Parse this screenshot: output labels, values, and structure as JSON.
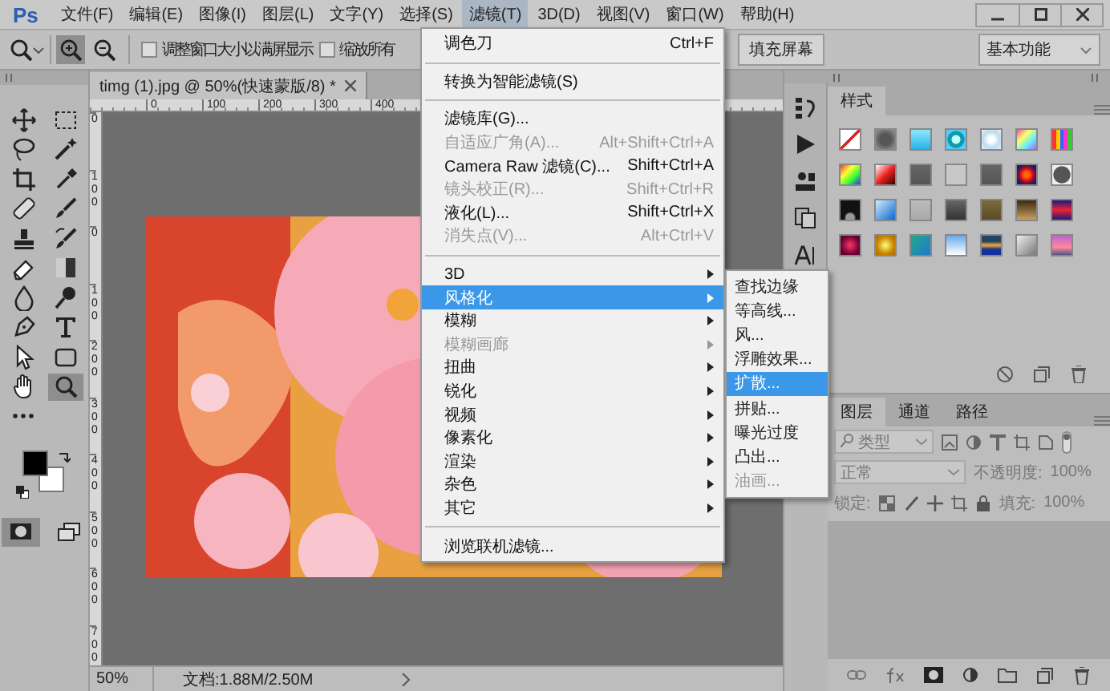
{
  "menubar": {
    "logo": "Ps",
    "menus": [
      {
        "label": "文件(F)",
        "selected": false
      },
      {
        "label": "编辑(E)",
        "selected": false
      },
      {
        "label": "图像(I)",
        "selected": false
      },
      {
        "label": "图层(L)",
        "selected": false
      },
      {
        "label": "文字(Y)",
        "selected": false
      },
      {
        "label": "选择(S)",
        "selected": false
      },
      {
        "label": "滤镜(T)",
        "selected": true
      },
      {
        "label": "3D(D)",
        "selected": false
      },
      {
        "label": "视图(V)",
        "selected": false
      },
      {
        "label": "窗口(W)",
        "selected": false
      },
      {
        "label": "帮助(H)",
        "selected": false
      }
    ]
  },
  "options_bar": {
    "zoom_buttons": [
      {
        "kind": "zoom-in",
        "selected": true
      },
      {
        "kind": "zoom-out",
        "selected": false
      }
    ],
    "checkboxes": [
      {
        "label": "调整窗口大小以满屏显示",
        "checked": false
      },
      {
        "label": "缩放所有",
        "checked": false
      }
    ],
    "fill_screen_button": "填充屏幕",
    "workspace": "基本功能"
  },
  "tools": [
    {
      "kind": "move",
      "selected": false
    },
    {
      "kind": "marquee",
      "selected": false
    },
    {
      "kind": "lasso",
      "selected": false
    },
    {
      "kind": "wand",
      "selected": false
    },
    {
      "kind": "crop",
      "selected": false
    },
    {
      "kind": "eyedropper",
      "selected": false
    },
    {
      "kind": "healing",
      "selected": false
    },
    {
      "kind": "brush",
      "selected": false
    },
    {
      "kind": "stamp",
      "selected": false
    },
    {
      "kind": "history-brush",
      "selected": false
    },
    {
      "kind": "eraser",
      "selected": false
    },
    {
      "kind": "gradient",
      "selected": false
    },
    {
      "kind": "blur",
      "selected": false
    },
    {
      "kind": "dodge",
      "selected": false
    },
    {
      "kind": "pen",
      "selected": false
    },
    {
      "kind": "type",
      "selected": false
    },
    {
      "kind": "path-select",
      "selected": false
    },
    {
      "kind": "rectangle",
      "selected": false
    },
    {
      "kind": "hand",
      "selected": false
    },
    {
      "kind": "zoom",
      "selected": true
    },
    {
      "kind": "more",
      "selected": false
    }
  ],
  "quick_mask": {
    "selected": true
  },
  "document": {
    "tab": "timg (1).jpg @ 50%(快速蒙版/8) *",
    "ruler_h": [
      "0",
      "100",
      "200",
      "300",
      "400"
    ],
    "ruler_v": [
      "0",
      "100",
      "0",
      "100",
      "200",
      "300",
      "400",
      "500",
      "600",
      "700"
    ],
    "image": {
      "kind": "picture"
    },
    "status": {
      "zoom": "50%",
      "doc_info": "文档:1.88M/2.50M"
    }
  },
  "filter_menu": {
    "items": [
      {
        "kind": "item",
        "label": "调色刀",
        "shortcut": "Ctrl+F",
        "disabled": false,
        "submenu": false,
        "selected": false
      },
      {
        "kind": "separator"
      },
      {
        "kind": "item",
        "label": "转换为智能滤镜(S)",
        "disabled": false,
        "submenu": false,
        "selected": false
      },
      {
        "kind": "separator"
      },
      {
        "kind": "item",
        "label": "滤镜库(G)...",
        "disabled": false,
        "submenu": false,
        "selected": false
      },
      {
        "kind": "item",
        "label": "自适应广角(A)...",
        "shortcut": "Alt+Shift+Ctrl+A",
        "disabled": true,
        "submenu": false,
        "selected": false
      },
      {
        "kind": "item",
        "label": "Camera Raw 滤镜(C)...",
        "shortcut": "Shift+Ctrl+A",
        "disabled": false,
        "submenu": false,
        "selected": false
      },
      {
        "kind": "item",
        "label": "镜头校正(R)...",
        "shortcut": "Shift+Ctrl+R",
        "disabled": true,
        "submenu": false,
        "selected": false
      },
      {
        "kind": "item",
        "label": "液化(L)...",
        "shortcut": "Shift+Ctrl+X",
        "disabled": false,
        "submenu": false,
        "selected": false
      },
      {
        "kind": "item",
        "label": "消失点(V)...",
        "shortcut": "Alt+Ctrl+V",
        "disabled": true,
        "submenu": false,
        "selected": false
      },
      {
        "kind": "separator"
      },
      {
        "kind": "item",
        "label": "3D",
        "disabled": false,
        "submenu": true,
        "selected": false
      },
      {
        "kind": "item",
        "label": "风格化",
        "disabled": false,
        "submenu": true,
        "selected": true
      },
      {
        "kind": "item",
        "label": "模糊",
        "disabled": false,
        "submenu": true,
        "selected": false
      },
      {
        "kind": "item",
        "label": "模糊画廊",
        "disabled": true,
        "submenu": true,
        "selected": false
      },
      {
        "kind": "item",
        "label": "扭曲",
        "disabled": false,
        "submenu": true,
        "selected": false
      },
      {
        "kind": "item",
        "label": "锐化",
        "disabled": false,
        "submenu": true,
        "selected": false
      },
      {
        "kind": "item",
        "label": "视频",
        "disabled": false,
        "submenu": true,
        "selected": false
      },
      {
        "kind": "item",
        "label": "像素化",
        "disabled": false,
        "submenu": true,
        "selected": false
      },
      {
        "kind": "item",
        "label": "渲染",
        "disabled": false,
        "submenu": true,
        "selected": false
      },
      {
        "kind": "item",
        "label": "杂色",
        "disabled": false,
        "submenu": true,
        "selected": false
      },
      {
        "kind": "item",
        "label": "其它",
        "disabled": false,
        "submenu": true,
        "selected": false
      },
      {
        "kind": "separator"
      },
      {
        "kind": "item",
        "label": "浏览联机滤镜...",
        "disabled": false,
        "submenu": false,
        "selected": false
      }
    ]
  },
  "stylize_submenu": {
    "items": [
      {
        "label": "查找边缘",
        "disabled": false,
        "selected": false
      },
      {
        "label": "等高线...",
        "disabled": false,
        "selected": false
      },
      {
        "label": "风...",
        "disabled": false,
        "selected": false
      },
      {
        "label": "浮雕效果...",
        "disabled": false,
        "selected": false
      },
      {
        "label": "扩散...",
        "disabled": false,
        "selected": true
      },
      {
        "label": "拼贴...",
        "disabled": false,
        "selected": false
      },
      {
        "label": "曝光过度",
        "disabled": false,
        "selected": false
      },
      {
        "label": "凸出...",
        "disabled": false,
        "selected": false
      },
      {
        "label": "油画...",
        "disabled": true,
        "selected": false
      }
    ]
  },
  "styles_panel": {
    "tab": "样式"
  },
  "layers_panel": {
    "tabs": [
      {
        "label": "图层",
        "selected": true
      },
      {
        "label": "通道",
        "selected": false
      },
      {
        "label": "路径",
        "selected": false
      }
    ],
    "filter": "类型",
    "blend_mode": "正常",
    "opacity_label": "不透明度:",
    "opacity": "100%",
    "lock_label": "锁定:",
    "fill_label": "填充:",
    "fill": "100%"
  }
}
